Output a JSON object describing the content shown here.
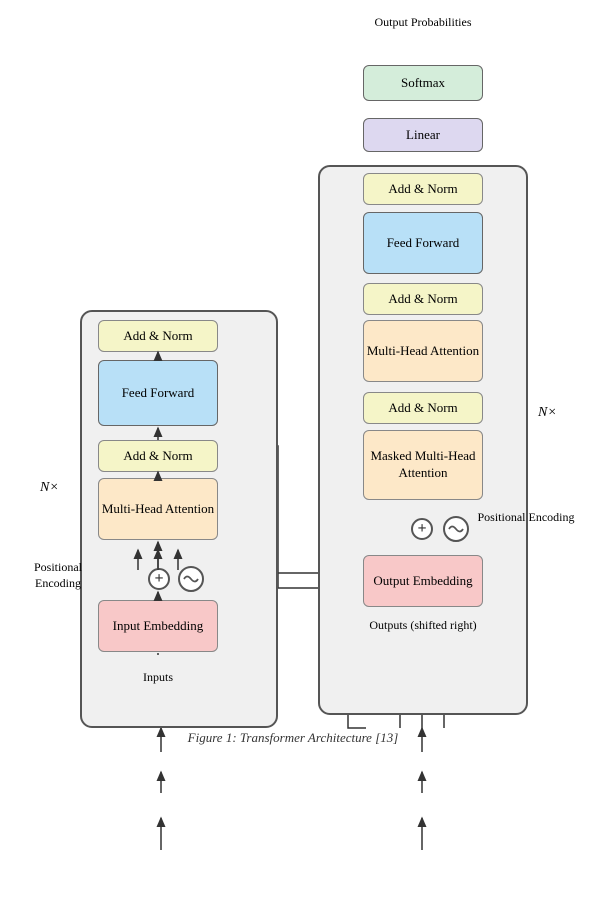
{
  "title": "Transformer Architecture",
  "caption": "Figure 1: Transformer Architecture [13]",
  "encoder": {
    "label": "N×",
    "blocks": {
      "add_norm_top": "Add & Norm",
      "feed_forward": "Feed\nForward",
      "add_norm_bottom": "Add & Norm",
      "multi_head": "Multi-Head\nAttention",
      "embedding": "Input\nEmbedding",
      "positional": "Positional\nEncoding",
      "inputs": "Inputs"
    }
  },
  "decoder": {
    "label": "N×",
    "blocks": {
      "softmax": "Softmax",
      "linear": "Linear",
      "add_norm_top": "Add & Norm",
      "feed_forward": "Feed\nForward",
      "add_norm_mid": "Add & Norm",
      "multi_head": "Multi-Head\nAttention",
      "add_norm_bottom": "Add & Norm",
      "masked": "Masked\nMulti-Head\nAttention",
      "embedding": "Output\nEmbedding",
      "positional": "Positional\nEncoding",
      "outputs": "Outputs\n(shifted right)",
      "output_probs": "Output\nProbabilities"
    }
  }
}
